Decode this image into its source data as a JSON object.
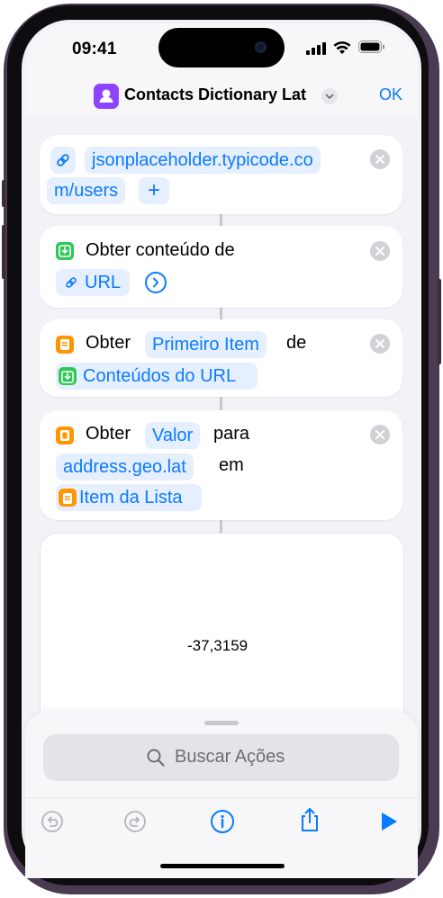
{
  "status": {
    "time": "09:41"
  },
  "nav": {
    "title": "Contacts Dictionary Lat",
    "done": "OK"
  },
  "actions": [
    {
      "url_line1": "jsonplaceholder.typicode.co",
      "url_line2": "m/users",
      "add": "+"
    },
    {
      "verb": "Obter conteúdo de",
      "param": "URL"
    },
    {
      "verb": "Obter",
      "param1": "Primeiro Item",
      "connector": "de",
      "param2": "Conteúdos do URL"
    },
    {
      "verb": "Obter",
      "param1": "Valor",
      "connector1": "para",
      "param2": "address.geo.lat",
      "connector2": "em",
      "param3": "Item da Lista"
    }
  ],
  "result": {
    "value": "-37,3159"
  },
  "search": {
    "placeholder": "Buscar Ações"
  },
  "toolbar": {
    "undo": "undo-icon",
    "redo": "redo-icon",
    "info": "info-icon",
    "share": "share-icon",
    "play": "play-icon"
  },
  "colors": {
    "accent": "#0a7aff",
    "shortcut_icon": "#8e44ff",
    "web_icon": "#30c759",
    "script_icon": "#ff9500"
  }
}
